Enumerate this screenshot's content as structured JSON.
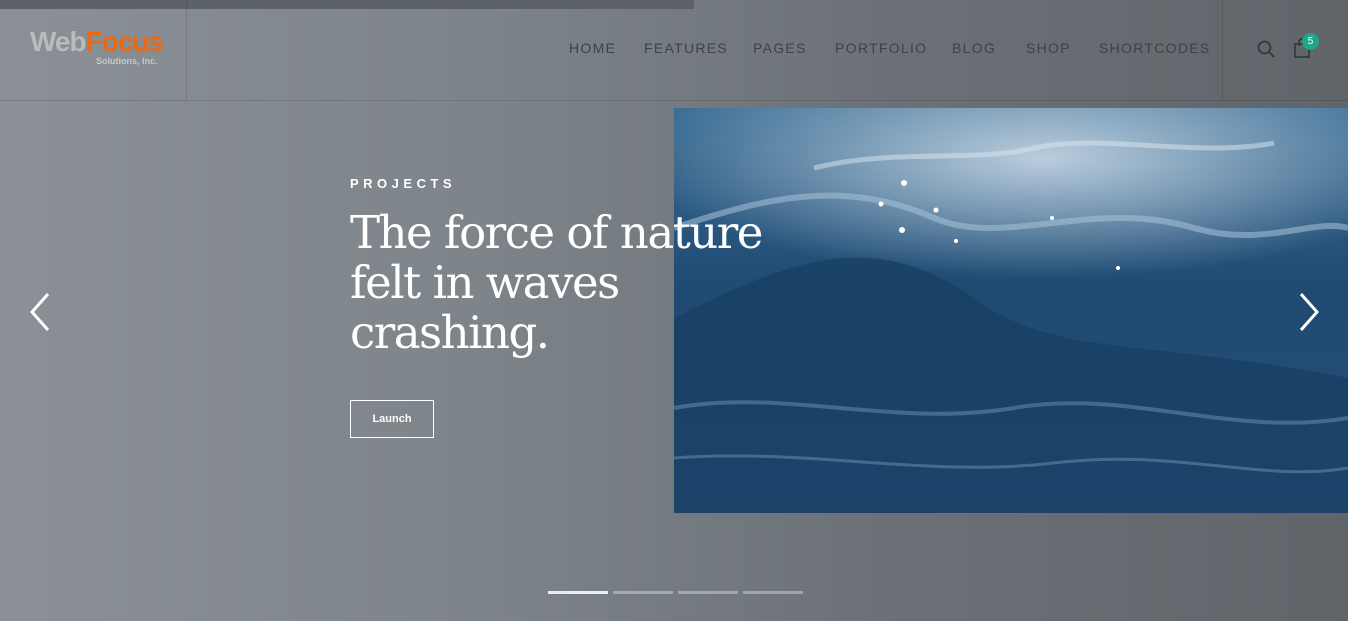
{
  "logo": {
    "word1": "Web",
    "word2": "Focus",
    "tagline": "Solutions, Inc."
  },
  "nav": {
    "items": [
      {
        "label": "HOME"
      },
      {
        "label": "FEATURES"
      },
      {
        "label": "PAGES"
      },
      {
        "label": "PORTFOLIO"
      },
      {
        "label": "BLOG"
      },
      {
        "label": "SHOP"
      },
      {
        "label": "SHORTCODES"
      }
    ]
  },
  "header_icons": {
    "search": "search-icon",
    "cart": "shopping-bag-icon",
    "cart_count": "5",
    "badge_color": "#1fa589"
  },
  "slider": {
    "eyebrow": "PROJECTS",
    "headline": "The force of nature felt in waves crashing.",
    "button_label": "Launch",
    "prev_icon": "chevron-left-icon",
    "next_icon": "chevron-right-icon",
    "slide_count": 4,
    "active_slide": 1
  },
  "colors": {
    "accent_logo": "#e76a14",
    "text_light": "#ffffff",
    "nav_text": "#3e4246"
  }
}
